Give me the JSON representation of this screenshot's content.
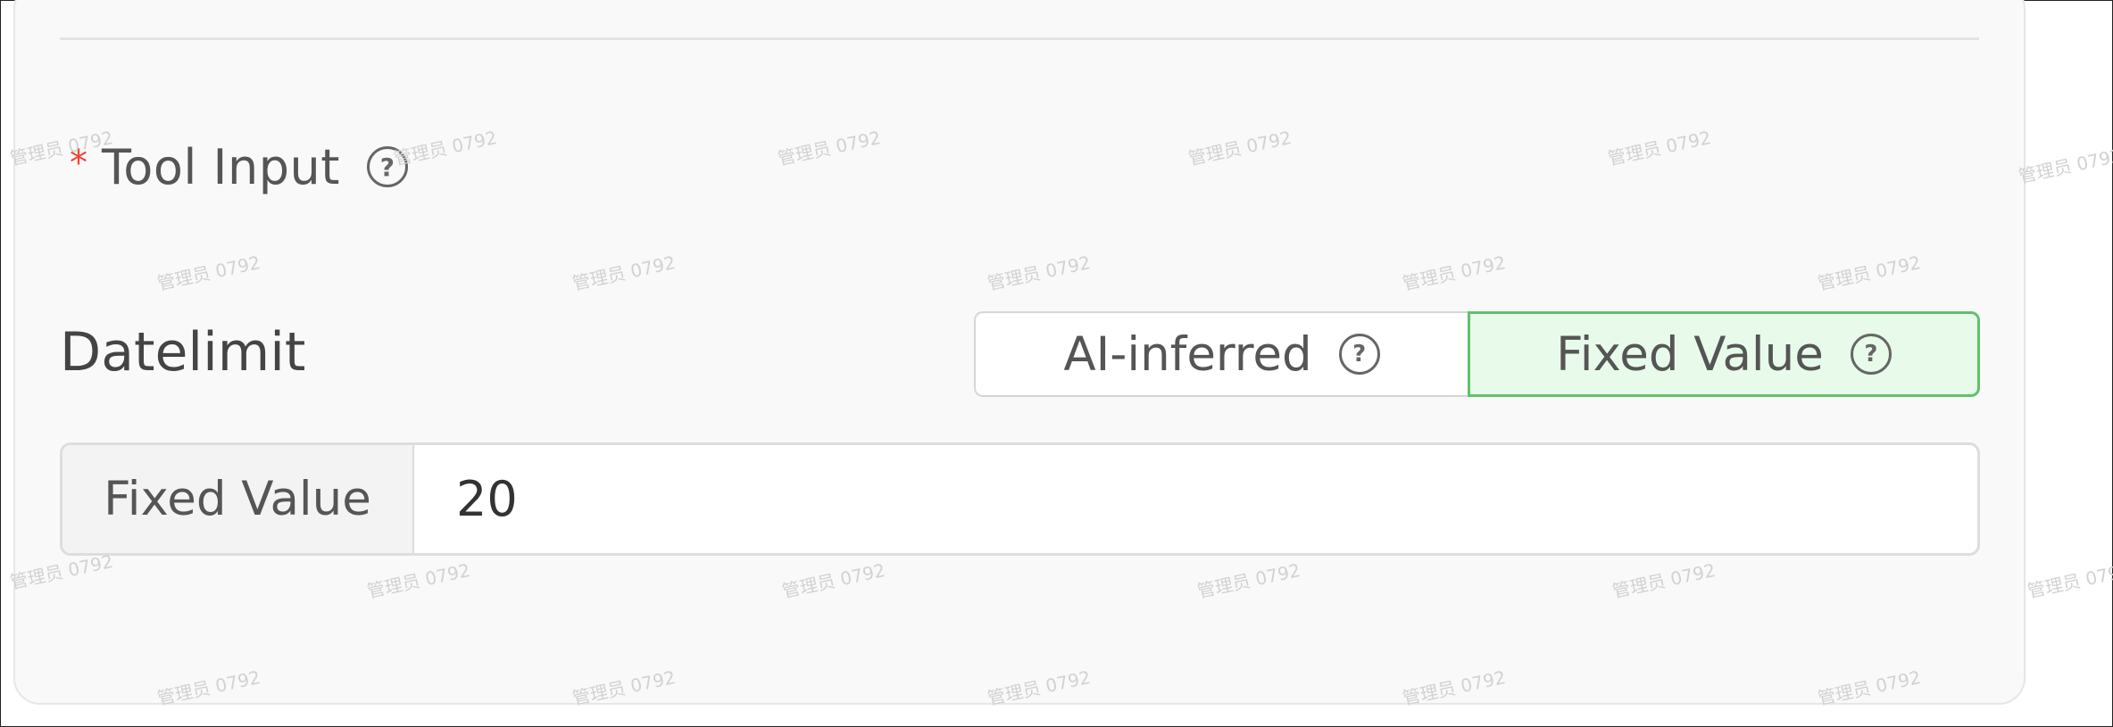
{
  "tool_input": {
    "required_marker": "*",
    "title": "Tool Input",
    "help_icon": "question-circle-icon"
  },
  "parameter": {
    "name": "Datelimit",
    "modes": [
      {
        "label": "AI-inferred",
        "selected": false,
        "help_icon": "question-circle-icon"
      },
      {
        "label": "Fixed Value",
        "selected": true,
        "help_icon": "question-circle-icon"
      }
    ],
    "input": {
      "addon_label": "Fixed Value",
      "value": "20"
    }
  },
  "colors": {
    "selected_bg": "#e8fbeb",
    "selected_border": "#5ec26a",
    "required": "#f04438"
  },
  "watermark_text": "管理员 0792"
}
